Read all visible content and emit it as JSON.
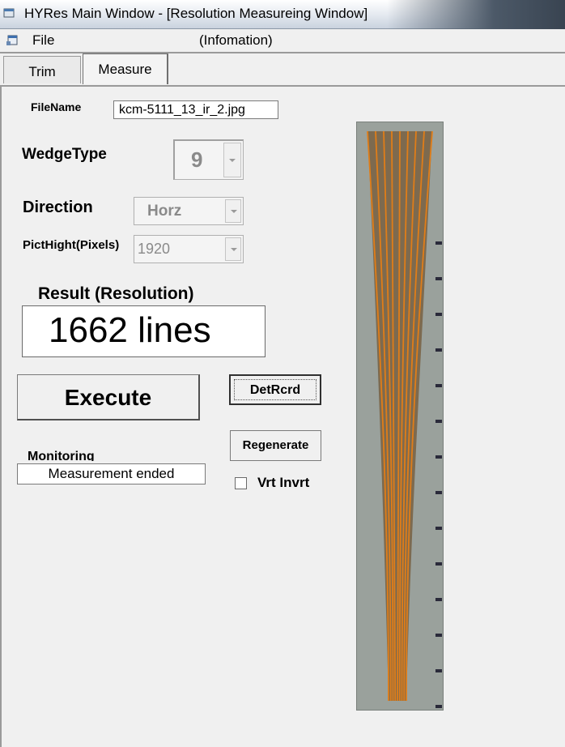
{
  "window": {
    "title": "HYRes Main Window - [Resolution Measureing Window]"
  },
  "menu": {
    "file": "File",
    "info": "(Infomation)"
  },
  "tabs": [
    {
      "label": "Trim",
      "selected": false
    },
    {
      "label": "Measure",
      "selected": true
    }
  ],
  "form": {
    "filename_label": "FileName",
    "filename_value": "kcm-5111_13_ir_2.jpg",
    "wedge_type_label": "WedgeType",
    "wedge_type_value": "9",
    "direction_label": "Direction",
    "direction_value": "Horz",
    "pict_height_label": "PictHight(Pixels)",
    "pict_height_value": "1920",
    "result_label": "Result (Resolution)",
    "result_value": "1662 lines",
    "monitoring_label": "Monitoring",
    "monitoring_value": "Measurement ended",
    "vrt_invrt_label": "Vrt Invrt",
    "vrt_invrt_checked": false
  },
  "buttons": {
    "execute": "Execute",
    "detrcrd": "DetRcrd",
    "regenerate": "Regenerate"
  },
  "image": {
    "background_color": "#9aa19c",
    "line_color": "#e07d18",
    "tick_color": "#2a2a3a",
    "line_count": 9,
    "tick_count": 14
  }
}
